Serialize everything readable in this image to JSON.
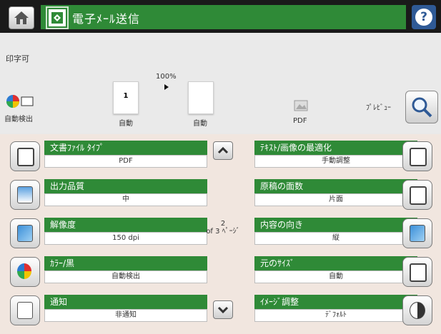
{
  "header": {
    "title": "電子ﾒｰﾙ送信",
    "home_icon": "home-icon",
    "scan_icon": "scan-start-icon",
    "help_label": "?"
  },
  "status": {
    "message": "印字可",
    "auto_detect_label": "自動検出",
    "page_number": "1",
    "zoom": "100%",
    "page1_label": "自動",
    "page2_label": "自動",
    "pdf_label": "PDF",
    "preview_label": "ﾌﾟﾚﾋﾞｭｰ"
  },
  "pager": {
    "page": "2",
    "of_text": "of 3 ﾍﾟｰｼﾞ"
  },
  "left_settings": [
    {
      "title": "文書ﾌｧｲﾙ ﾀｲﾌﾟ",
      "value": "PDF"
    },
    {
      "title": "出力品質",
      "value": "中"
    },
    {
      "title": "解像度",
      "value": "150 dpi"
    },
    {
      "title": "ｶﾗｰ/黒",
      "value": "自動検出"
    },
    {
      "title": "通知",
      "value": "非通知"
    }
  ],
  "right_settings": [
    {
      "title": "ﾃｷｽﾄ/画像の最適化",
      "value": "手動調整"
    },
    {
      "title": "原稿の面数",
      "value": "片面"
    },
    {
      "title": "内容の向き",
      "value": "縦"
    },
    {
      "title": "元のｻｲｽﾞ",
      "value": "自動"
    },
    {
      "title": "ｲﾒｰｼﾞ調整",
      "value": "ﾃﾞﾌｫﾙﾄ"
    }
  ],
  "colors": {
    "accent_green": "#2f8a37",
    "panel_bg": "#f1e6df",
    "help_blue": "#2f5a96"
  }
}
